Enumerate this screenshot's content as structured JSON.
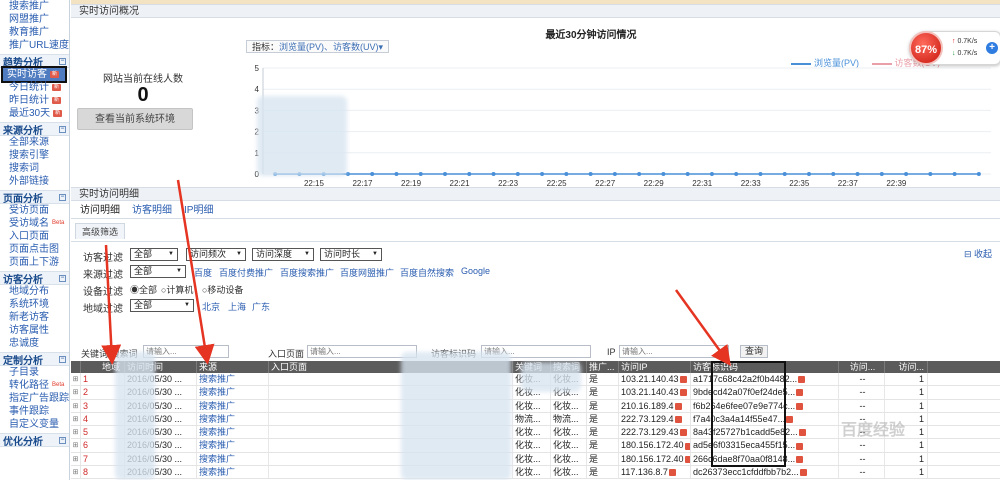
{
  "sidebar": {
    "groups": [
      {
        "label": "",
        "items": [
          {
            "label": "搜索推广"
          },
          {
            "label": "网盟推广"
          },
          {
            "label": "教育推广"
          },
          {
            "label": "推广URL速度"
          }
        ]
      },
      {
        "label": "趋势分析",
        "items": [
          {
            "label": "实时访客",
            "badge": "新"
          },
          {
            "label": "今日统计",
            "badge": "新"
          },
          {
            "label": "昨日统计",
            "badge": "新"
          },
          {
            "label": "最近30天",
            "badge": "新"
          }
        ]
      },
      {
        "label": "来源分析",
        "items": [
          {
            "label": "全部来源"
          },
          {
            "label": "搜索引擎"
          },
          {
            "label": "搜索词"
          },
          {
            "label": "外部链接"
          }
        ]
      },
      {
        "label": "页面分析",
        "items": [
          {
            "label": "受访页面"
          },
          {
            "label": "受访域名",
            "badge": "Beta"
          },
          {
            "label": "入口页面"
          },
          {
            "label": "页面点击图"
          },
          {
            "label": "页面上下游"
          }
        ]
      },
      {
        "label": "访客分析",
        "items": [
          {
            "label": "地域分布"
          },
          {
            "label": "系统环境"
          },
          {
            "label": "新老访客"
          },
          {
            "label": "访客属性"
          },
          {
            "label": "忠诚度"
          }
        ]
      },
      {
        "label": "定制分析",
        "items": [
          {
            "label": "子目录"
          },
          {
            "label": "转化路径",
            "badge": "Beta"
          },
          {
            "label": "指定广告跟踪"
          },
          {
            "label": "事件跟踪"
          },
          {
            "label": "自定义变量"
          }
        ]
      },
      {
        "label": "优化分析",
        "items": []
      }
    ]
  },
  "overview": {
    "section_title": "实时访问概况",
    "online_label": "网站当前在线人数",
    "online_count": "0",
    "env_button": "查看当前系统环境",
    "metric_label": "指标：",
    "metric_value": "浏览量(PV)、访客数(UV)▾",
    "speed_percent": "87%",
    "speed_up": "0.7K/s",
    "speed_down": "0.7K/s",
    "speed_plus": "+"
  },
  "chart_data": {
    "type": "line",
    "title": "最近30分钟访问情况",
    "x": [
      "22:15",
      "22:17",
      "22:19",
      "22:21",
      "22:23",
      "22:25",
      "22:27",
      "22:29",
      "22:31",
      "22:33",
      "22:35",
      "22:37",
      "22:39"
    ],
    "series": [
      {
        "name": "浏览量(PV)",
        "values": [
          0,
          0,
          0,
          0,
          0,
          0,
          0,
          0,
          0,
          0,
          0,
          0,
          0
        ]
      },
      {
        "name": "访客数(UV)",
        "values": [
          0,
          0,
          0,
          0,
          0,
          0,
          0,
          0,
          0,
          0,
          0,
          0,
          0
        ]
      }
    ],
    "yticks": [
      "5",
      "4",
      "3",
      "2",
      "1",
      "0"
    ],
    "ylim": [
      0,
      5
    ],
    "legend": "top-right",
    "colors": {
      "pv": "#4a90d9",
      "uv": "#e9a0a8"
    }
  },
  "detail": {
    "section_title": "实时访问明细",
    "tabs": [
      {
        "label": "访问明细"
      },
      {
        "label": "访客明细"
      },
      {
        "label": "IP明细"
      }
    ],
    "subtab": "高级筛选",
    "collapse": "⊟ 收起",
    "filters": {
      "visitor_label": "访客过滤",
      "visitor_all": "全部",
      "visit_freq": "访问频次",
      "visit_depth": "访问深度",
      "visit_duration": "访问时长",
      "source_label": "来源过滤",
      "source_all": "全部",
      "source_links": [
        "百度",
        "百度付费推广",
        "百度搜索推广",
        "百度网盟推广",
        "百度自然搜索",
        "Google"
      ],
      "device_label": "设备过滤",
      "device_options": [
        "◉全部",
        "○计算机",
        "○移动设备"
      ],
      "region_label": "地域过滤",
      "region_all": "全部",
      "region_links": [
        "北京",
        "上海",
        "广东"
      ]
    },
    "search": {
      "keyword_label": "关键词/搜索词",
      "keyword_placeholder": "请输入...",
      "entry_label": "入口页面",
      "entry_placeholder": "请输入...",
      "visitor_id_label": "访客标识码",
      "visitor_id_placeholder": "请输入...",
      "ip_label": "IP",
      "ip_placeholder": "请输入...",
      "query_button": "查询"
    },
    "table": {
      "headers": [
        "地域",
        "访问时间",
        "来源",
        "入口页面",
        "关键词",
        "搜索词",
        "推广...",
        "访问IP",
        "访客标识码",
        "访问...",
        "访问..."
      ],
      "rows": [
        {
          "num": "1",
          "time": "2016/05/30 ...",
          "source": "搜索推广",
          "kw": "化妆...",
          "se": "化妆...",
          "promo": "是",
          "ip": "103.21.140.43",
          "vid": "a1717c68c42a2f0b4482...",
          "dur": "--",
          "cnt": "1"
        },
        {
          "num": "2",
          "time": "2016/05/30 ...",
          "source": "搜索推广",
          "kw": "化妆...",
          "se": "化妆...",
          "promo": "是",
          "ip": "103.21.140.43",
          "vid": "9bdecd42a07f0ef24de5...",
          "dur": "--",
          "cnt": "1"
        },
        {
          "num": "3",
          "time": "2016/05/30 ...",
          "source": "搜索推广",
          "kw": "化妆...",
          "se": "化妆...",
          "promo": "是",
          "ip": "210.16.189.4",
          "vid": "f6b264e6fee07e9e774c...",
          "dur": "--",
          "cnt": "1"
        },
        {
          "num": "4",
          "time": "2016/05/30 ...",
          "source": "搜索推广",
          "kw": "物流...",
          "se": "物流...",
          "promo": "是",
          "ip": "222.73.129.4",
          "vid": "f7a40c3a4a14f55e47...",
          "dur": "--",
          "cnt": "1"
        },
        {
          "num": "5",
          "time": "2016/05/30 ...",
          "source": "搜索推广",
          "kw": "化妆...",
          "se": "化妆...",
          "promo": "是",
          "ip": "222.73.129.43",
          "vid": "8a43f25727b1cadd5e82...",
          "dur": "--",
          "cnt": "1"
        },
        {
          "num": "6",
          "time": "2016/05/30 ...",
          "source": "搜索推广",
          "kw": "化妆...",
          "se": "化妆...",
          "promo": "是",
          "ip": "180.156.172.40",
          "vid": "ad5e6f03315eca455f15...",
          "dur": "--",
          "cnt": "1"
        },
        {
          "num": "7",
          "time": "2016/05/30 ...",
          "source": "搜索推广",
          "kw": "化妆...",
          "se": "化妆...",
          "promo": "是",
          "ip": "180.156.172.40",
          "vid": "266c6dae8f70aa0f8148...",
          "dur": "--",
          "cnt": "1"
        },
        {
          "num": "8",
          "time": "2016/05/30 ...",
          "source": "搜索推广",
          "kw": "化妆...",
          "se": "化妆...",
          "promo": "是",
          "ip": "117.136.8.7",
          "vid": "dc26373ecc1cfddfbb7b2...",
          "dur": "--",
          "cnt": "1"
        }
      ]
    }
  },
  "watermark": "百度经验"
}
